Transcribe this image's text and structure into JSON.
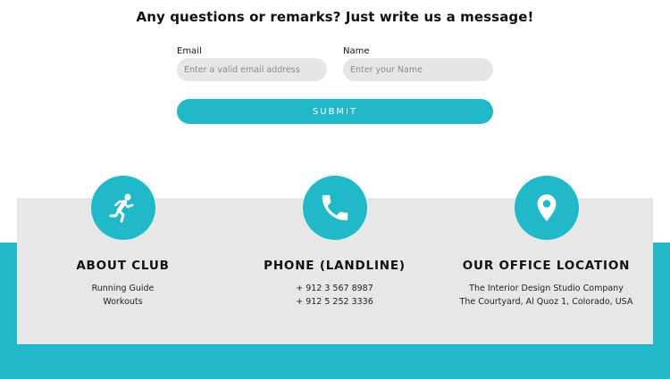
{
  "contact_form": {
    "heading": "Any questions or remarks? Just write us a message!",
    "email_label": "Email",
    "email_placeholder": "Enter a valid email address",
    "name_label": "Name",
    "name_placeholder": "Enter your Name",
    "submit_label": "SUBMIT"
  },
  "info_columns": [
    {
      "icon": "running-person-icon",
      "title": "ABOUT CLUB",
      "lines": [
        "Running Guide",
        "Workouts"
      ]
    },
    {
      "icon": "phone-icon",
      "title": "PHONE (LANDLINE)",
      "lines": [
        "+ 912 3 567 8987",
        "+ 912 5 252 3336"
      ]
    },
    {
      "icon": "location-pin-icon",
      "title": "OUR OFFICE LOCATION",
      "lines": [
        "The Interior Design Studio Company",
        "The Courtyard, Al Quoz 1, Colorado,  USA"
      ]
    }
  ],
  "colors": {
    "accent": "#21b9c9",
    "card_background": "#e7e7e7",
    "input_background": "#e6e6e6"
  }
}
